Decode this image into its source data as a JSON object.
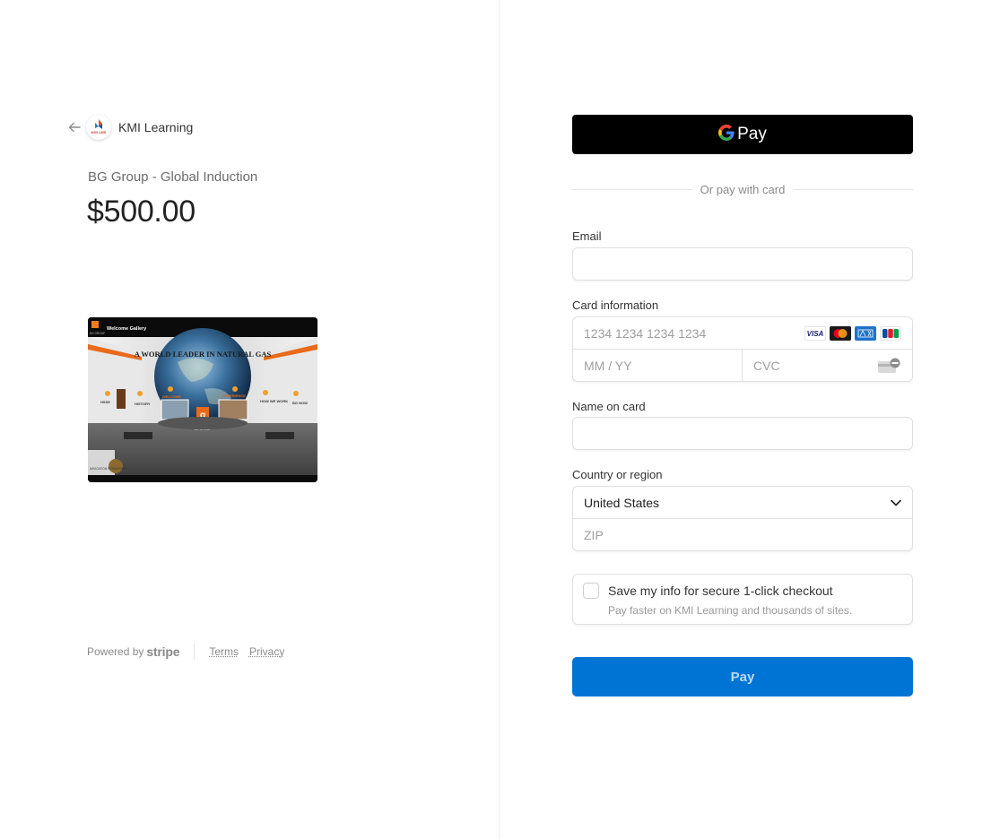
{
  "merchant": {
    "name": "KMI Learning",
    "logo_text": "KMI LMS"
  },
  "product": {
    "name": "BG Group - Global Induction",
    "price": "$500.00"
  },
  "product_image": {
    "gallery_label": "Welcome Gallery",
    "brand_short": "BG GROUP",
    "banner": "A WORLD LEADER IN NATURAL GAS",
    "panels": [
      "HSSE",
      "HISTORY",
      "WELCOME",
      "EXPERIENCE",
      "HOW WE WORK",
      "BG NOW"
    ],
    "nav_label": "NAVIGATION RESOURCES",
    "logo_letter": "g"
  },
  "footer": {
    "powered_by": "Powered by",
    "stripe": "stripe",
    "terms": "Terms",
    "privacy": "Privacy"
  },
  "gpay": {
    "label": "Pay"
  },
  "divider_text": "Or pay with card",
  "email": {
    "label": "Email",
    "placeholder": ""
  },
  "card": {
    "label": "Card information",
    "number_placeholder": "1234 1234 1234 1234",
    "expiry_placeholder": "MM / YY",
    "cvc_placeholder": "CVC",
    "brands": [
      "VISA",
      "mastercard",
      "amex",
      "JCB"
    ]
  },
  "name_on_card": {
    "label": "Name on card",
    "placeholder": ""
  },
  "country": {
    "label": "Country or region",
    "value": "United States",
    "zip_placeholder": "ZIP"
  },
  "save_info": {
    "title": "Save my info for secure 1-click checkout",
    "subtitle": "Pay faster on KMI Learning and thousands of sites."
  },
  "pay_button": {
    "label": "Pay"
  },
  "colors": {
    "accent": "#0074d4",
    "gpay_bg": "#000000",
    "border": "#e0e0e0"
  }
}
